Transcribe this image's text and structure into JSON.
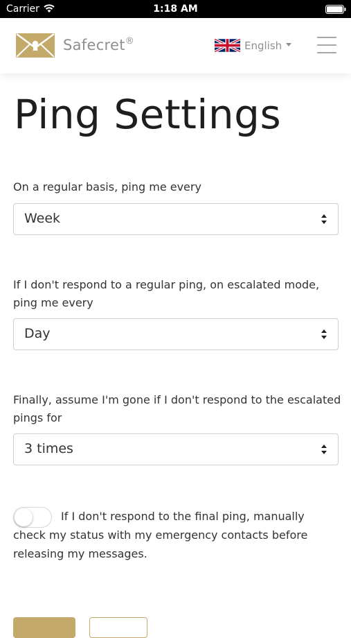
{
  "status_bar": {
    "carrier": "Carrier",
    "time": "1:18 AM"
  },
  "header": {
    "brand": "Safecret",
    "brand_mark": "®",
    "language": "English",
    "brand_color": "#c4aa6a"
  },
  "page": {
    "title": "Ping Settings"
  },
  "settings": {
    "regular": {
      "label": "On a regular basis, ping me every",
      "value": "Week"
    },
    "escalated": {
      "label": "If I don't respond to a regular ping, on escalated mode, ping me every",
      "value": "Day"
    },
    "final": {
      "label": "Finally, assume I'm gone if I don't respond to the escalated pings for",
      "value": "3 times"
    },
    "manual_check": {
      "label": "If I don't respond to the final ping, manually check my status with my emergency contacts before releasing my messages.",
      "enabled": false
    }
  },
  "icons": {
    "logo": "envelope-keyhole-icon",
    "language_flag": "uk-flag-icon",
    "menu": "hamburger-menu-icon",
    "select_arrows": "up-down-arrows-icon"
  }
}
